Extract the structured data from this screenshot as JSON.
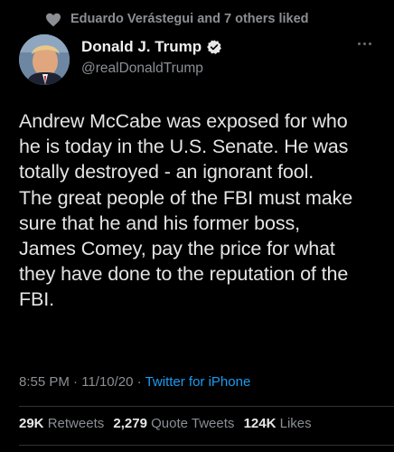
{
  "social_context": {
    "text": "Eduardo Verástegui and 7 others liked",
    "icon": "heart-icon"
  },
  "author": {
    "display_name": "Donald J. Trump",
    "handle": "@realDonaldTrump",
    "verified": true
  },
  "tweet": {
    "text": "Andrew McCabe was exposed for who\nhe is today in the U.S. Senate. He was\ntotally destroyed - an ignorant fool.\nThe great people of the FBI must make\nsure that he and his former boss,\nJames Comey, pay the price for what\nthey have done to the reputation of the\nFBI.",
    "time": "8:55 PM",
    "date": "11/10/20",
    "source": "Twitter for iPhone"
  },
  "stats": {
    "retweets_count": "29K",
    "retweets_label": "Retweets",
    "quotes_count": "2,279",
    "quotes_label": "Quote Tweets",
    "likes_count": "124K",
    "likes_label": "Likes"
  },
  "colors": {
    "background": "#000000",
    "accent": "#1d9bf0",
    "muted": "#8b8f93"
  }
}
